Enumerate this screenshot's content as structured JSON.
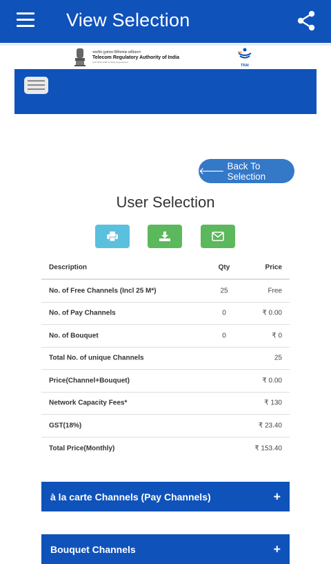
{
  "appbar": {
    "title": "View Selection",
    "menu_icon": "hamburger-menu-icon",
    "share_icon": "share-icon"
  },
  "header": {
    "hindi_name": "भारतीय दूरसंचार विनियामक प्राधिकरण",
    "org_name": "Telecom Regulatory Authority of India",
    "org_sub": "(ISO 9001:2008 Certified Organisation)",
    "logo_caption": "TRAI"
  },
  "back_button": {
    "label": "Back To Selection",
    "icon": "arrow-left-icon"
  },
  "heading": "User Selection",
  "actions": [
    {
      "name": "print",
      "icon": "print-icon",
      "color": "#5bc0de"
    },
    {
      "name": "download",
      "icon": "download-icon",
      "color": "#5cb85c"
    },
    {
      "name": "email",
      "icon": "envelope-icon",
      "color": "#5cb85c"
    }
  ],
  "table": {
    "headers": {
      "description": "Description",
      "qty": "Qty",
      "price": "Price"
    },
    "rows": [
      {
        "description": "No. of Free Channels (Incl 25 M*)",
        "qty": "25",
        "price": "Free"
      },
      {
        "description": "No. of Pay Channels",
        "qty": "0",
        "price": "₹ 0.00"
      },
      {
        "description": "No. of Bouquet",
        "qty": "0",
        "price": "₹ 0"
      },
      {
        "description": "Total No. of unique Channels",
        "qty": "",
        "price": "25"
      },
      {
        "description": "Price(Channel+Bouquet)",
        "qty": "",
        "price": "₹ 0.00"
      },
      {
        "description": "Network Capacity Fees*",
        "qty": "",
        "price": "₹ 130"
      },
      {
        "description": "GST(18%)",
        "qty": "",
        "price": "₹ 23.40"
      },
      {
        "description": "Total Price(Monthly)",
        "qty": "",
        "price": "₹ 153.40"
      }
    ]
  },
  "accordions": [
    {
      "label": "à la carte Channels (Pay Channels)",
      "icon": "+"
    },
    {
      "label": "Bouquet Channels",
      "icon": "+"
    }
  ],
  "colors": {
    "primary": "#0f52ba",
    "back_button": "#3478c8",
    "info": "#5bc0de",
    "success": "#5cb85c"
  }
}
